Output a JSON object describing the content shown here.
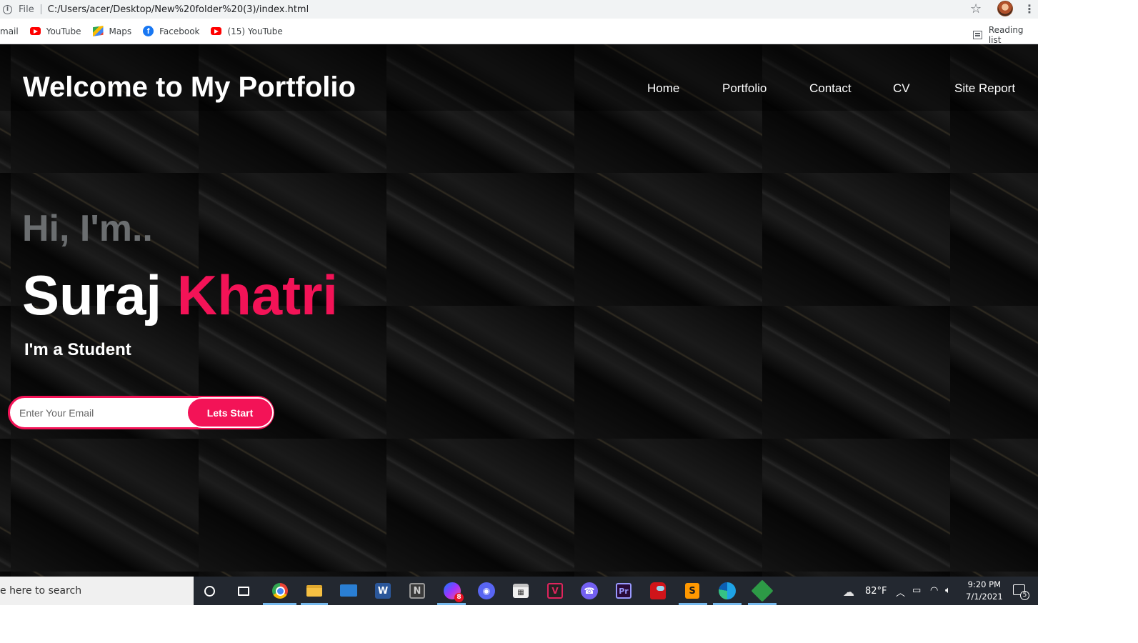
{
  "browser": {
    "address_prefix": "File",
    "url": "C:/Users/acer/Desktop/New%20folder%20(3)/index.html",
    "bookmarks": [
      {
        "label": "mail"
      },
      {
        "label": "YouTube",
        "icon": "youtube-icon"
      },
      {
        "label": "Maps",
        "icon": "maps-icon"
      },
      {
        "label": "Facebook",
        "icon": "facebook-icon"
      },
      {
        "label": "(15) YouTube",
        "icon": "youtube-icon"
      }
    ],
    "reading_list": "Reading list"
  },
  "site": {
    "title": "Welcome to My Portfolio",
    "nav": [
      {
        "label": "Home"
      },
      {
        "label": "Portfolio"
      },
      {
        "label": "Contact"
      },
      {
        "label": "CV"
      },
      {
        "label": "Site Report"
      }
    ],
    "greeting": "Hi, I'm..",
    "first_name": "Suraj",
    "last_name": "Khatri",
    "role": "I'm a Student",
    "email_placeholder": "Enter Your Email",
    "cta_label": "Lets Start",
    "accent_color": "#f31357"
  },
  "taskbar": {
    "search_text": "e here to search",
    "messenger_badge": "8",
    "weather": "82°F",
    "time": "9:20 PM",
    "date": "7/1/2021",
    "notification_count": "5",
    "apps": [
      "chrome",
      "file-explorer",
      "mail",
      "word",
      "notion",
      "messenger",
      "discord",
      "store",
      "vivaldi",
      "viber",
      "premiere",
      "among-us",
      "sublime-text",
      "edge",
      "gitkraken"
    ]
  }
}
